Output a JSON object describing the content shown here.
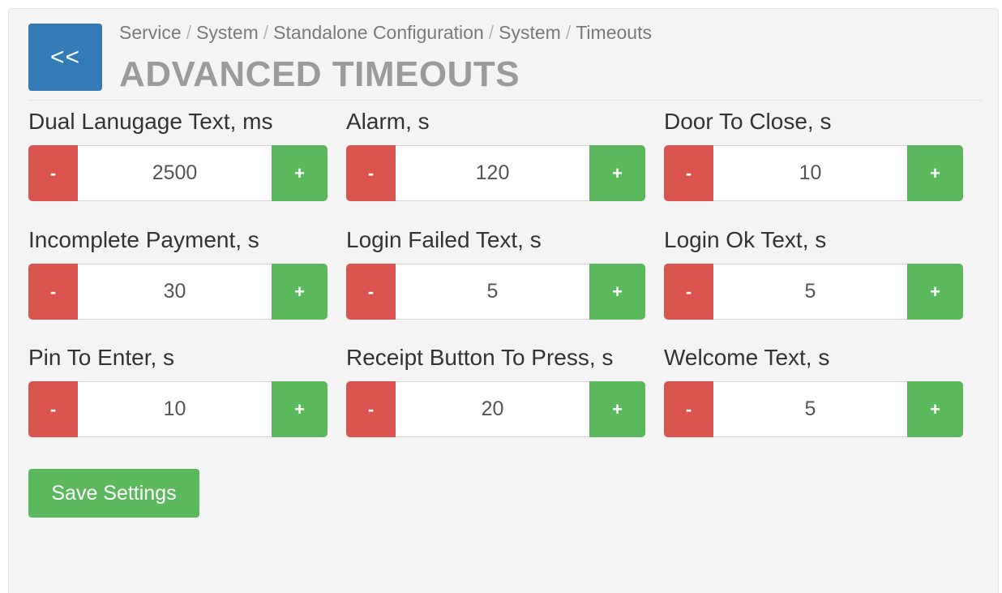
{
  "header": {
    "back_label": "<<",
    "breadcrumb": [
      "Service",
      "System",
      "Standalone Configuration",
      "System",
      "Timeouts"
    ],
    "separator": "/",
    "title": "ADVANCED TIMEOUTS"
  },
  "stepper": {
    "decrement_label": "-",
    "increment_label": "+"
  },
  "fields": [
    {
      "label": "Dual Lanugage Text, ms",
      "value": "2500"
    },
    {
      "label": "Alarm, s",
      "value": "120"
    },
    {
      "label": "Door To Close, s",
      "value": "10"
    },
    {
      "label": "Incomplete Payment, s",
      "value": "30"
    },
    {
      "label": "Login Failed Text, s",
      "value": "5"
    },
    {
      "label": "Login Ok Text, s",
      "value": "5"
    },
    {
      "label": "Pin To Enter, s",
      "value": "10"
    },
    {
      "label": "Receipt Button To Press, s",
      "value": "20"
    },
    {
      "label": "Welcome Text, s",
      "value": "5"
    }
  ],
  "actions": {
    "save_label": "Save Settings"
  },
  "colors": {
    "back_button": "#337ab7",
    "decrement": "#d9534f",
    "increment": "#5cb85c",
    "save_button": "#5cb85c",
    "title": "#9b9b9b"
  }
}
